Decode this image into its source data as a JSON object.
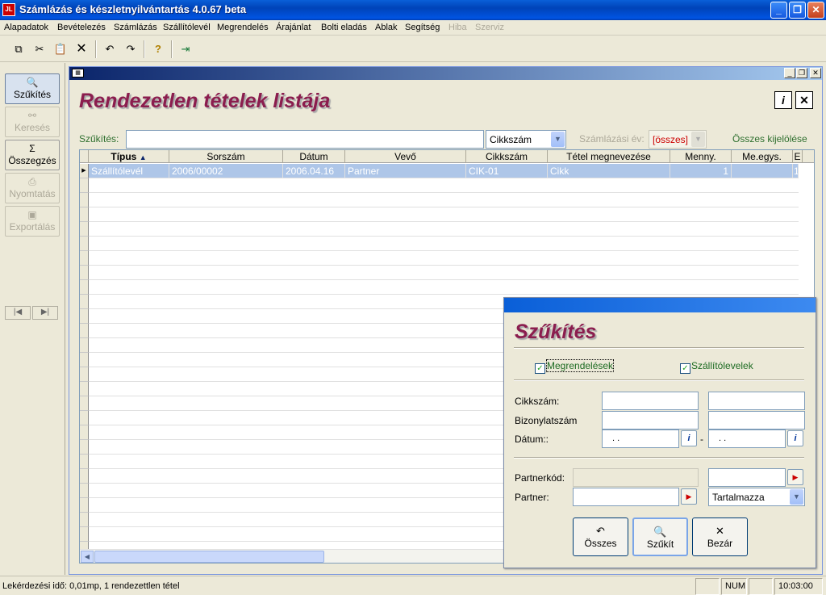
{
  "window": {
    "title": "Számlázás és készletnyilvántartás 4.0.67 beta",
    "icon_text": "JL"
  },
  "menu": [
    "Alapadatok",
    "Bevételezés",
    "Számlázás",
    "Szállítólevél",
    "Megrendelés",
    "Árajánlat",
    "Bolti eladás",
    "Ablak",
    "Segítség",
    "Hiba",
    "Szerviz"
  ],
  "toolbar": {
    "icons": [
      "copy-icon",
      "cut-icon",
      "paste-icon",
      "delete-icon",
      "undo-icon",
      "redo-icon",
      "help-icon",
      "exit-icon"
    ]
  },
  "left_panel": {
    "buttons": [
      {
        "label": "Szűkítés",
        "icon": "filter-icon",
        "state": "active"
      },
      {
        "label": "Keresés",
        "icon": "binoculars-icon",
        "state": "disabled"
      },
      {
        "label": "Összegzés",
        "icon": "sigma-icon",
        "state": "normal"
      },
      {
        "label": "Nyomtatás",
        "icon": "printer-icon",
        "state": "disabled"
      },
      {
        "label": "Exportálás",
        "icon": "disk-icon",
        "state": "disabled"
      }
    ]
  },
  "main": {
    "heading": "Rendezetlen tételek listája",
    "filter": {
      "label": "Szűkítés:",
      "value": "",
      "field_select": "Cikkszám",
      "year_label": "Számlázási év:",
      "year_select": "[összes]",
      "select_all": "Összes kijelölése"
    },
    "grid": {
      "columns": [
        "Típus",
        "Sorszám",
        "Dátum",
        "Vevő",
        "Cikkszám",
        "Tétel megnevezése",
        "Menny.",
        "Me.egys.",
        "E"
      ],
      "rows": [
        [
          "Szállítólevél",
          "2006/00002",
          "2006.04.16",
          "Partner",
          "CIK-01",
          "Cikk",
          "1",
          "",
          "1"
        ]
      ]
    }
  },
  "dialog": {
    "heading": "Szűkítés",
    "checkboxes": {
      "orders": "Megrendelések",
      "delivery": "Szállítólevelek"
    },
    "labels": {
      "item_code": "Cikkszám:",
      "doc_number": "Bizonylatszám",
      "date": "Dátum::",
      "partner_code": "Partnerkód:",
      "partner": "Partner:"
    },
    "date_from": ". .",
    "date_to": ". .",
    "date_dash": "-",
    "match_select": "Tartalmazza",
    "buttons": {
      "all": "Összes",
      "filter": "Szűkít",
      "close": "Bezár"
    }
  },
  "status": {
    "text": "Lekérdezési idő: 0,01mp, 1 rendezettlen tétel",
    "num": "NUM",
    "time": "10:03:00"
  }
}
